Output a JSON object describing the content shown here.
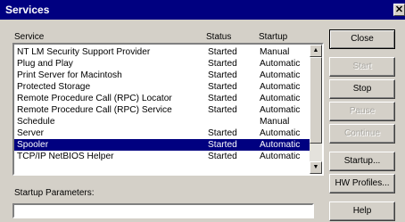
{
  "window": {
    "title": "Services",
    "close_glyph": "✕"
  },
  "list": {
    "headers": {
      "service": "Service",
      "status": "Status",
      "startup": "Startup"
    },
    "rows": [
      {
        "service": "NT LM Security Support Provider",
        "status": "Started",
        "startup": "Manual"
      },
      {
        "service": "Plug and Play",
        "status": "Started",
        "startup": "Automatic"
      },
      {
        "service": "Print Server for Macintosh",
        "status": "Started",
        "startup": "Automatic"
      },
      {
        "service": "Protected Storage",
        "status": "Started",
        "startup": "Automatic"
      },
      {
        "service": "Remote Procedure Call (RPC) Locator",
        "status": "Started",
        "startup": "Automatic"
      },
      {
        "service": "Remote Procedure Call (RPC) Service",
        "status": "Started",
        "startup": "Automatic"
      },
      {
        "service": "Schedule",
        "status": "",
        "startup": "Manual"
      },
      {
        "service": "Server",
        "status": "Started",
        "startup": "Automatic"
      },
      {
        "service": "Spooler",
        "status": "Started",
        "startup": "Automatic"
      },
      {
        "service": "TCP/IP NetBIOS Helper",
        "status": "Started",
        "startup": "Automatic"
      }
    ],
    "selected_index": 8,
    "scrollbar": {
      "up_icon": "up-arrow-icon",
      "down_icon": "down-arrow-icon",
      "up_glyph": "▲",
      "down_glyph": "▼"
    }
  },
  "params": {
    "label": "Startup Parameters:",
    "value": ""
  },
  "buttons": [
    {
      "name": "close-button",
      "label": "Close",
      "enabled": true,
      "is_default": true
    },
    {
      "name": "start-button",
      "label": "Start",
      "enabled": false,
      "is_default": false
    },
    {
      "name": "stop-button",
      "label": "Stop",
      "enabled": true,
      "is_default": false
    },
    {
      "name": "pause-button",
      "label": "Pause",
      "enabled": false,
      "is_default": false
    },
    {
      "name": "continue-button",
      "label": "Continue",
      "enabled": false,
      "is_default": false
    },
    {
      "name": "startup-button",
      "label": "Startup...",
      "enabled": true,
      "is_default": false
    },
    {
      "name": "hw-profiles-button",
      "label": "HW Profiles...",
      "enabled": true,
      "is_default": false
    },
    {
      "name": "help-button",
      "label": "Help",
      "enabled": true,
      "is_default": false
    }
  ],
  "colors": {
    "titlebar": "#000080",
    "selection": "#000080",
    "face": "#d4d0c8",
    "disabled_text": "#a8a6a0"
  }
}
